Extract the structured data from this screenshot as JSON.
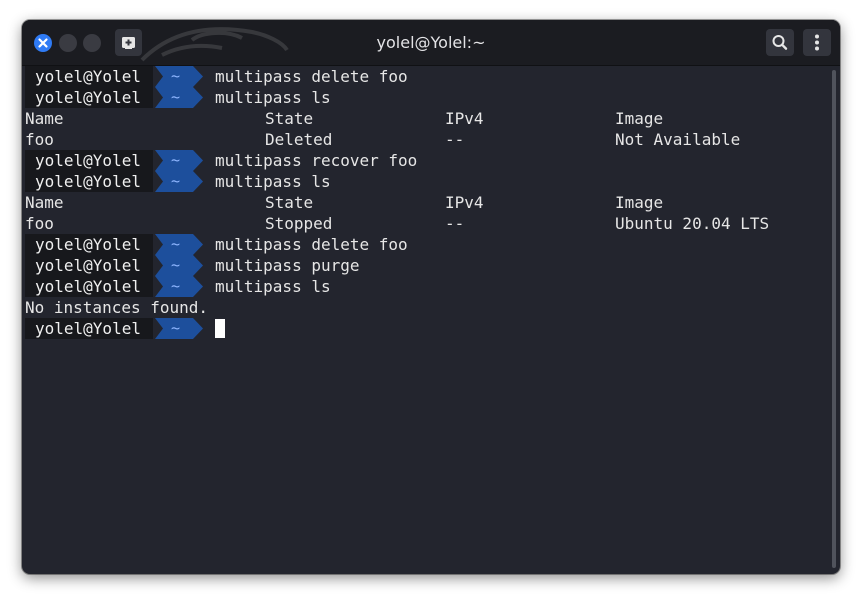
{
  "window": {
    "title": "yolel@Yolel:~",
    "accent": "#2f7bf5"
  },
  "prompt": {
    "user": "yolel@Yolel",
    "dir": "~",
    "dir_color": "#1d4f9c"
  },
  "lines": [
    {
      "type": "prompt",
      "cmd": "multipass delete foo"
    },
    {
      "type": "prompt",
      "cmd": "multipass ls"
    },
    {
      "type": "table",
      "cols": [
        "Name",
        "State",
        "IPv4",
        "Image"
      ]
    },
    {
      "type": "table",
      "cols": [
        "foo",
        "Deleted",
        "--",
        "Not Available"
      ]
    },
    {
      "type": "prompt",
      "cmd": "multipass recover foo"
    },
    {
      "type": "prompt",
      "cmd": "multipass ls"
    },
    {
      "type": "table",
      "cols": [
        "Name",
        "State",
        "IPv4",
        "Image"
      ]
    },
    {
      "type": "table",
      "cols": [
        "foo",
        "Stopped",
        "--",
        "Ubuntu 20.04 LTS"
      ]
    },
    {
      "type": "prompt",
      "cmd": "multipass delete foo"
    },
    {
      "type": "prompt",
      "cmd": "multipass purge"
    },
    {
      "type": "prompt",
      "cmd": "multipass ls"
    },
    {
      "type": "text",
      "text": "No instances found."
    },
    {
      "type": "cursor"
    }
  ],
  "icons": {
    "close": "close-icon",
    "new_tab": "new-tab-icon",
    "search": "search-icon",
    "menu": "kebab-menu-icon"
  }
}
